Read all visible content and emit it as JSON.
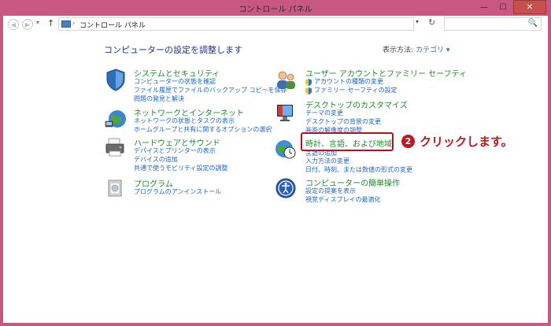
{
  "window": {
    "title": "コントロール パネル",
    "minimize": "—",
    "maximize": "☐",
    "close": "✕"
  },
  "addressbar": {
    "breadcrumb_sep": "›",
    "path": "コントロール パネル",
    "path_sep": "›",
    "dropdown": "▾",
    "refresh": "↻",
    "search_icon": "🔍"
  },
  "main": {
    "heading": "コンピューターの設定を調整します",
    "view_by_label": "表示方法:",
    "view_by_value": "カテゴリ ▾"
  },
  "categories": [
    {
      "title": "システムとセキュリティ",
      "links": [
        "コンピューターの状態を確認",
        "ファイル履歴でファイルのバックアップ コピーを保存",
        "問題の発見と解決"
      ],
      "icon": "shield-icon"
    },
    {
      "title": "ネットワークとインターネット",
      "links": [
        "ネットワークの状態とタスクの表示",
        "ホームグループと共有に関するオプションの選択"
      ],
      "icon": "network-icon"
    },
    {
      "title": "ハードウェアとサウンド",
      "links": [
        "デバイスとプリンターの表示",
        "デバイスの追加",
        "共通で使うモビリティ設定の調整"
      ],
      "icon": "printer-icon"
    },
    {
      "title": "プログラム",
      "links": [
        "プログラムのアンインストール"
      ],
      "icon": "programs-icon"
    },
    {
      "title": "ユーザー アカウントとファミリー セーフティ",
      "links": [
        "アカウントの種類の変更",
        "ファミリー セーフティの設定"
      ],
      "icon": "users-icon"
    },
    {
      "title": "デスクトップのカスタマイズ",
      "links": [
        "テーマの変更",
        "デスクトップの背景の変更",
        "画面の解像度の調整"
      ],
      "icon": "desktop-icon"
    },
    {
      "title": "時計、言語、および地域",
      "links": [
        "言語の追加",
        "入力方法の変更",
        "日付、時刻、または数値の形式の変更"
      ],
      "icon": "clock-globe-icon"
    },
    {
      "title": "コンピューターの簡単操作",
      "links": [
        "設定の提案を表示",
        "視覚ディスプレイの最適化"
      ],
      "icon": "ease-of-access-icon"
    }
  ],
  "callout": {
    "number": "2",
    "text": "クリックします。"
  },
  "colors": {
    "window_frame": "#c8587f",
    "category_title": "#1f8a2c",
    "link": "#1e64c8",
    "heading": "#1e3287",
    "highlight": "#b01222"
  }
}
